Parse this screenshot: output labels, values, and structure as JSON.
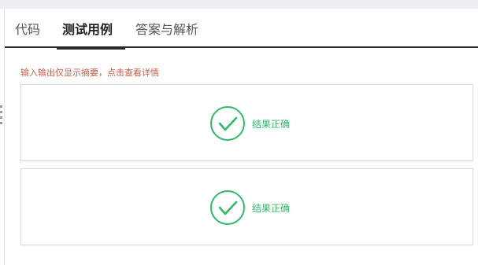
{
  "tabs": [
    {
      "label": "代码",
      "active": false
    },
    {
      "label": "测试用例",
      "active": true
    },
    {
      "label": "答案与解析",
      "active": false
    }
  ],
  "hint": "输入输出仅显示摘要，点击查看详情",
  "results": [
    {
      "label": "结果正确",
      "icon": "check-circle-icon"
    },
    {
      "label": "结果正确",
      "icon": "check-circle-icon"
    }
  ],
  "colors": {
    "success": "#32b86a",
    "hint": "#c8604a",
    "tab_underline": "#2b2b2b"
  }
}
